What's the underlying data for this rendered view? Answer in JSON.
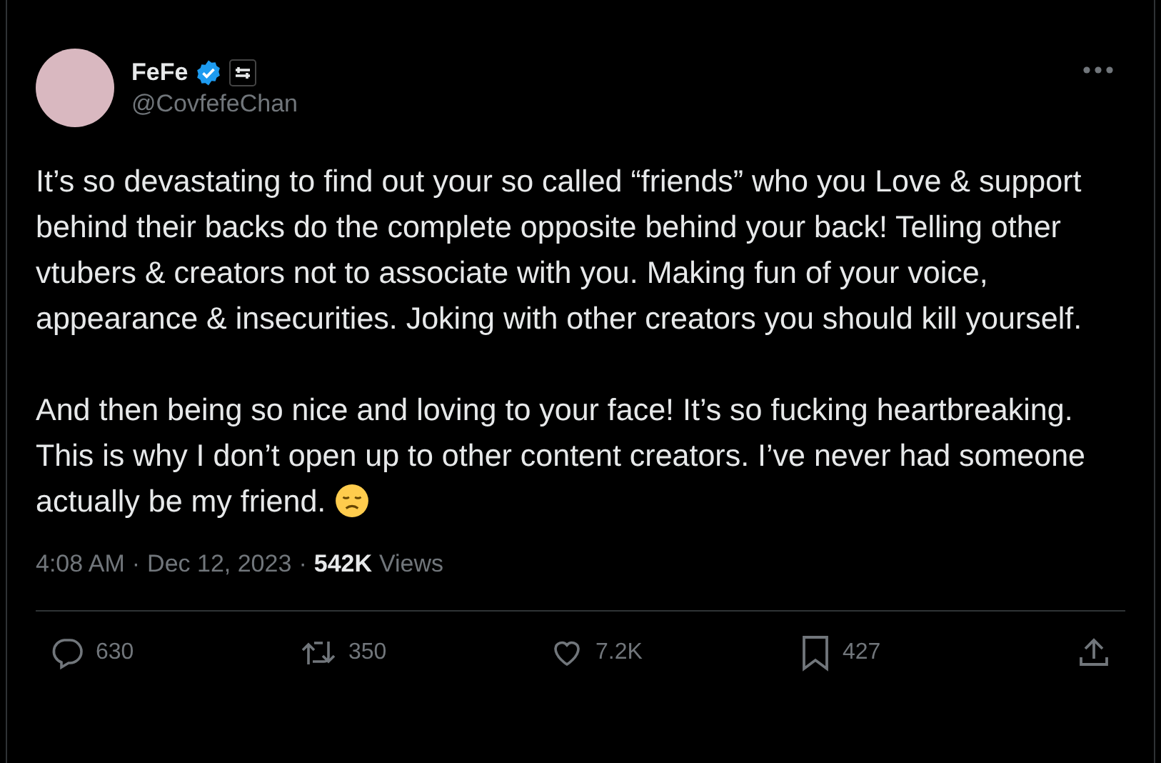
{
  "author": {
    "name": "FeFe",
    "verified": true,
    "handle": "@CovfefeChan"
  },
  "paragraphs": [
    "It’s so devastating to find out your so called “friends” who you Love & support behind their backs do the complete opposite behind your back! Telling other vtubers & creators not to associate with you. Making fun of your voice, appearance & insecurities. Joking with other creators you should kill yourself.",
    "And then being so nice and loving to your face! It’s so fucking heartbreaking. This is why I don’t open up to other content creators. I’ve never had someone actually be my friend."
  ],
  "meta": {
    "time": "4:08 AM",
    "separator": "·",
    "date": "Dec 12, 2023",
    "views_count": "542K",
    "views_label": "Views"
  },
  "actions": [
    {
      "kind": "reply",
      "count": "630"
    },
    {
      "kind": "repost",
      "count": "350"
    },
    {
      "kind": "like",
      "count": "7.2K"
    },
    {
      "kind": "bookmark",
      "count": "427"
    },
    {
      "kind": "share"
    }
  ]
}
